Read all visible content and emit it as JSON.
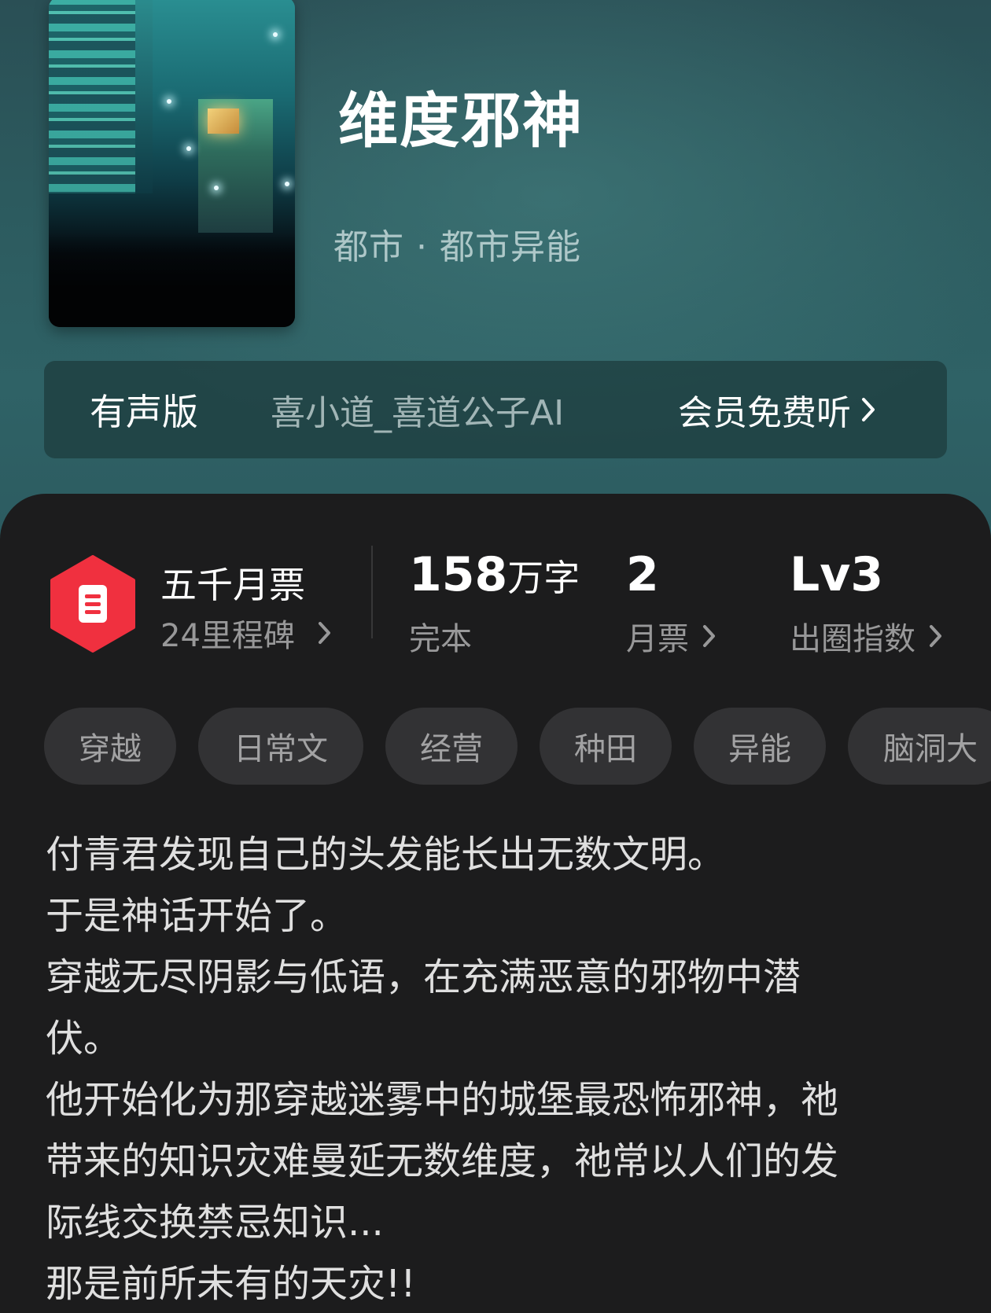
{
  "book": {
    "title": "维度邪神",
    "category": "都市 · 都市异能"
  },
  "audio": {
    "label": "有声版",
    "narrator": "喜小道_喜道公子AI",
    "cta": "会员免费听"
  },
  "stats": {
    "milestone": {
      "title": "五千月票",
      "subtitle": "24里程碑"
    },
    "words": {
      "number": "158",
      "unit": "万字",
      "status": "完本"
    },
    "monthly_ticket": {
      "value": "2",
      "label": "月票"
    },
    "influence": {
      "value": "Lv3",
      "label": "出圈指数"
    }
  },
  "tags": [
    "穿越",
    "日常文",
    "经营",
    "种田",
    "异能",
    "脑洞大"
  ],
  "synopsis": [
    "付青君发现自己的头发能长出无数文明。",
    "于是神话开始了。",
    "穿越无尽阴影与低语，在充满恶意的邪物中潜",
    "伏。",
    "他开始化为那穿越迷雾中的城堡最恐怖邪神，祂",
    "带来的知识灾难曼延无数维度，祂常以人们的发",
    "际线交换禁忌知识...",
    "那是前所未有的天灾!!"
  ],
  "colors": {
    "hero_bg": "#2c5a5e",
    "panel_bg": "#1c1c1d",
    "badge_red": "#f0303f",
    "tag_bg": "#323234"
  }
}
